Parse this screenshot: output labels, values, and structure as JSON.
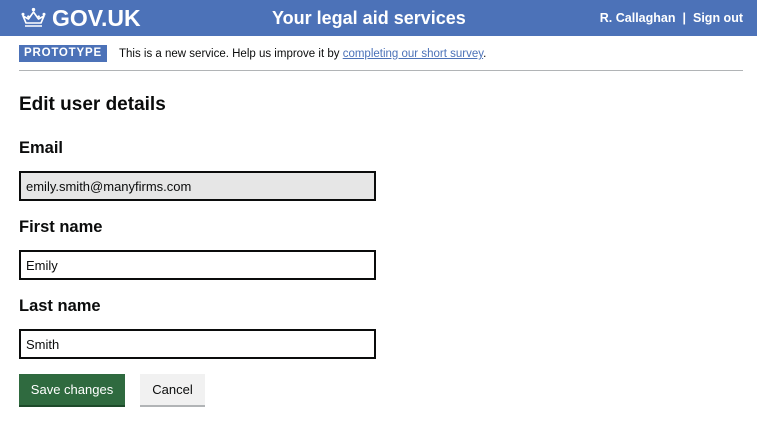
{
  "header": {
    "logo_text": "GOV.UK",
    "service_name": "Your legal aid services",
    "user_name": "R. Callaghan",
    "separator": "|",
    "sign_out": "Sign out"
  },
  "phase_banner": {
    "tag": "PROTOTYPE",
    "text_before": "This is a new service. Help us improve it by ",
    "link_text": "completing our short survey",
    "text_after": "."
  },
  "page_title": "Edit user details",
  "form": {
    "email": {
      "label": "Email",
      "value": "emily.smith@manyfirms.com",
      "readonly": true
    },
    "first_name": {
      "label": "First name",
      "value": "Emily"
    },
    "last_name": {
      "label": "Last name",
      "value": "Smith"
    }
  },
  "buttons": {
    "save": "Save changes",
    "cancel": "Cancel"
  },
  "colors": {
    "header_bg": "#4c72b8",
    "primary_button": "#2f6a3f",
    "readonly_field": "#e6e6e6",
    "link": "#4c72b8"
  },
  "icons": {
    "logo": "crown-icon"
  }
}
